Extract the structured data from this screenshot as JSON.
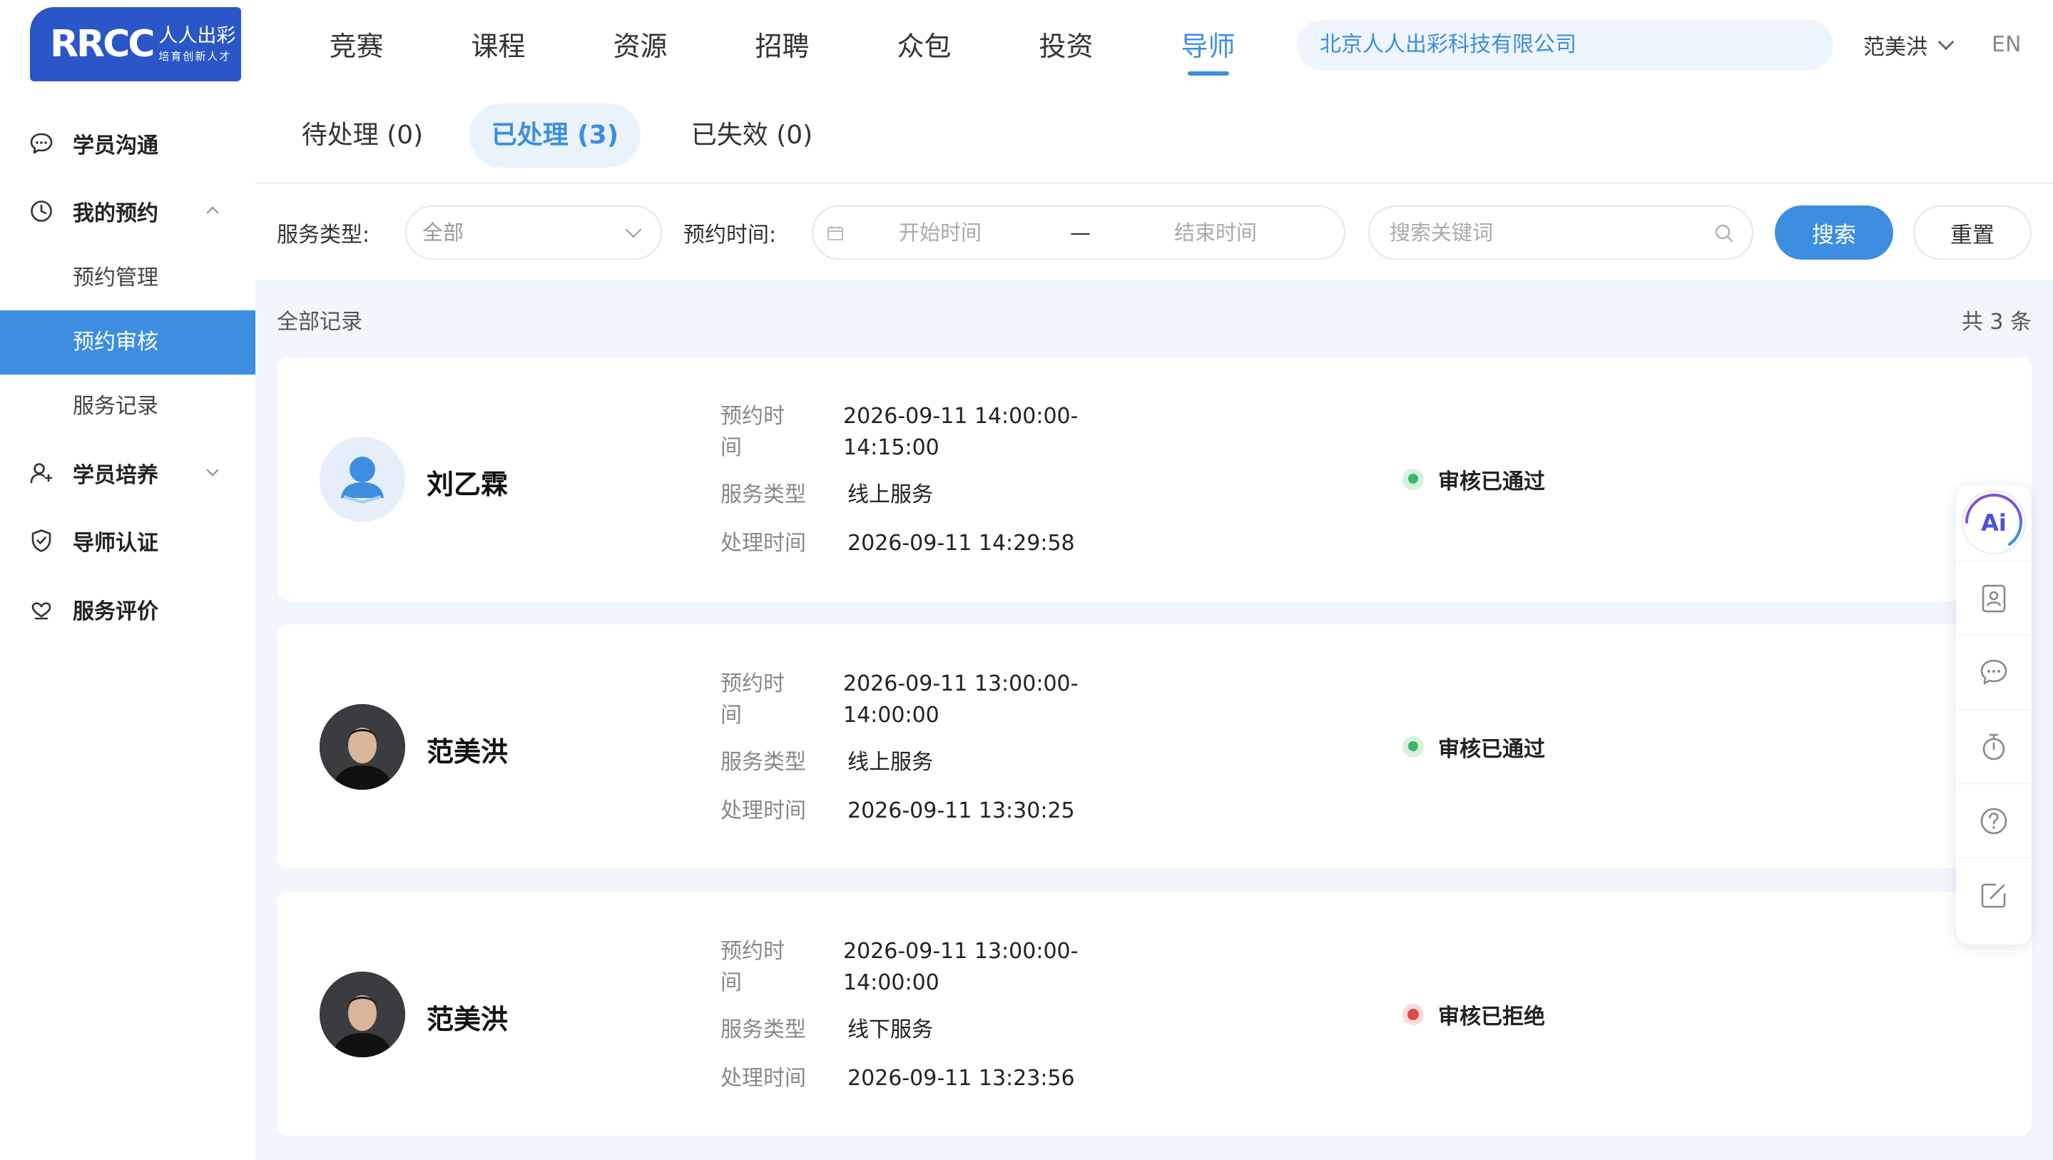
{
  "brand": {
    "logo_text": "RRCC",
    "logo_cn": "人人出彩",
    "logo_slogan": "培育创新人才"
  },
  "nav": {
    "items": [
      "竞赛",
      "课程",
      "资源",
      "招聘",
      "众包",
      "投资",
      "导师"
    ],
    "active": "导师"
  },
  "header": {
    "org_name": "北京人人出彩科技有限公司",
    "user_name": "范美洪",
    "lang": "EN"
  },
  "sidebar": {
    "items": [
      {
        "label": "学员沟通",
        "icon": "chat-bubble-icon"
      },
      {
        "label": "我的预约",
        "icon": "clock-icon",
        "expanded": true
      },
      {
        "label": "学员培养",
        "icon": "user-cultivate-icon",
        "expanded": false
      },
      {
        "label": "导师认证",
        "icon": "shield-check-icon"
      },
      {
        "label": "服务评价",
        "icon": "heart-hands-icon"
      }
    ],
    "sub_items": [
      "预约管理",
      "预约审核",
      "服务记录"
    ],
    "active_sub": "预约审核"
  },
  "tabs": [
    {
      "label": "待处理 (0)",
      "active": false
    },
    {
      "label": "已处理 (3)",
      "active": true
    },
    {
      "label": "已失效 (0)",
      "active": false
    }
  ],
  "filters": {
    "service_type_label": "服务类型:",
    "service_type_value": "全部",
    "time_label": "预约时间:",
    "start_placeholder": "开始时间",
    "range_sep": "—",
    "end_placeholder": "结束时间",
    "keyword_placeholder": "搜索关键词",
    "search_button": "搜索",
    "reset_button": "重置"
  },
  "records": {
    "title": "全部记录",
    "count_text": "共 3 条",
    "labels": {
      "time_a": "预约时",
      "time_b": "间",
      "service_type": "服务类型",
      "processed_time": "处理时间"
    },
    "items": [
      {
        "name": "刘乙霖",
        "time_1": "2026-09-11 14:00:00-",
        "time_2": "14:15:00",
        "service": "线上服务",
        "processed": "2026-09-11 14:29:58",
        "status": "审核已通过",
        "status_color": "#3db865"
      },
      {
        "name": "范美洪",
        "time_1": "2026-09-11 13:00:00-",
        "time_2": "14:00:00",
        "service": "线上服务",
        "processed": "2026-09-11 13:30:25",
        "status": "审核已通过",
        "status_color": "#3db865"
      },
      {
        "name": "范美洪",
        "time_1": "2026-09-11 13:00:00-",
        "time_2": "14:00:00",
        "service": "线下服务",
        "processed": "2026-09-11 13:23:56",
        "status": "审核已拒绝",
        "status_color": "#e04848"
      }
    ]
  },
  "float_toolbar": {
    "ai_label": "Ai",
    "icons": [
      "ai-assistant-icon",
      "contact-card-icon",
      "message-icon",
      "timer-icon",
      "help-icon",
      "edit-icon"
    ]
  },
  "colors": {
    "accent": "#3d8ee0",
    "brand": "#2a56c8",
    "content_bg": "#f1f6fc",
    "success": "#3db865",
    "danger": "#e04848"
  }
}
